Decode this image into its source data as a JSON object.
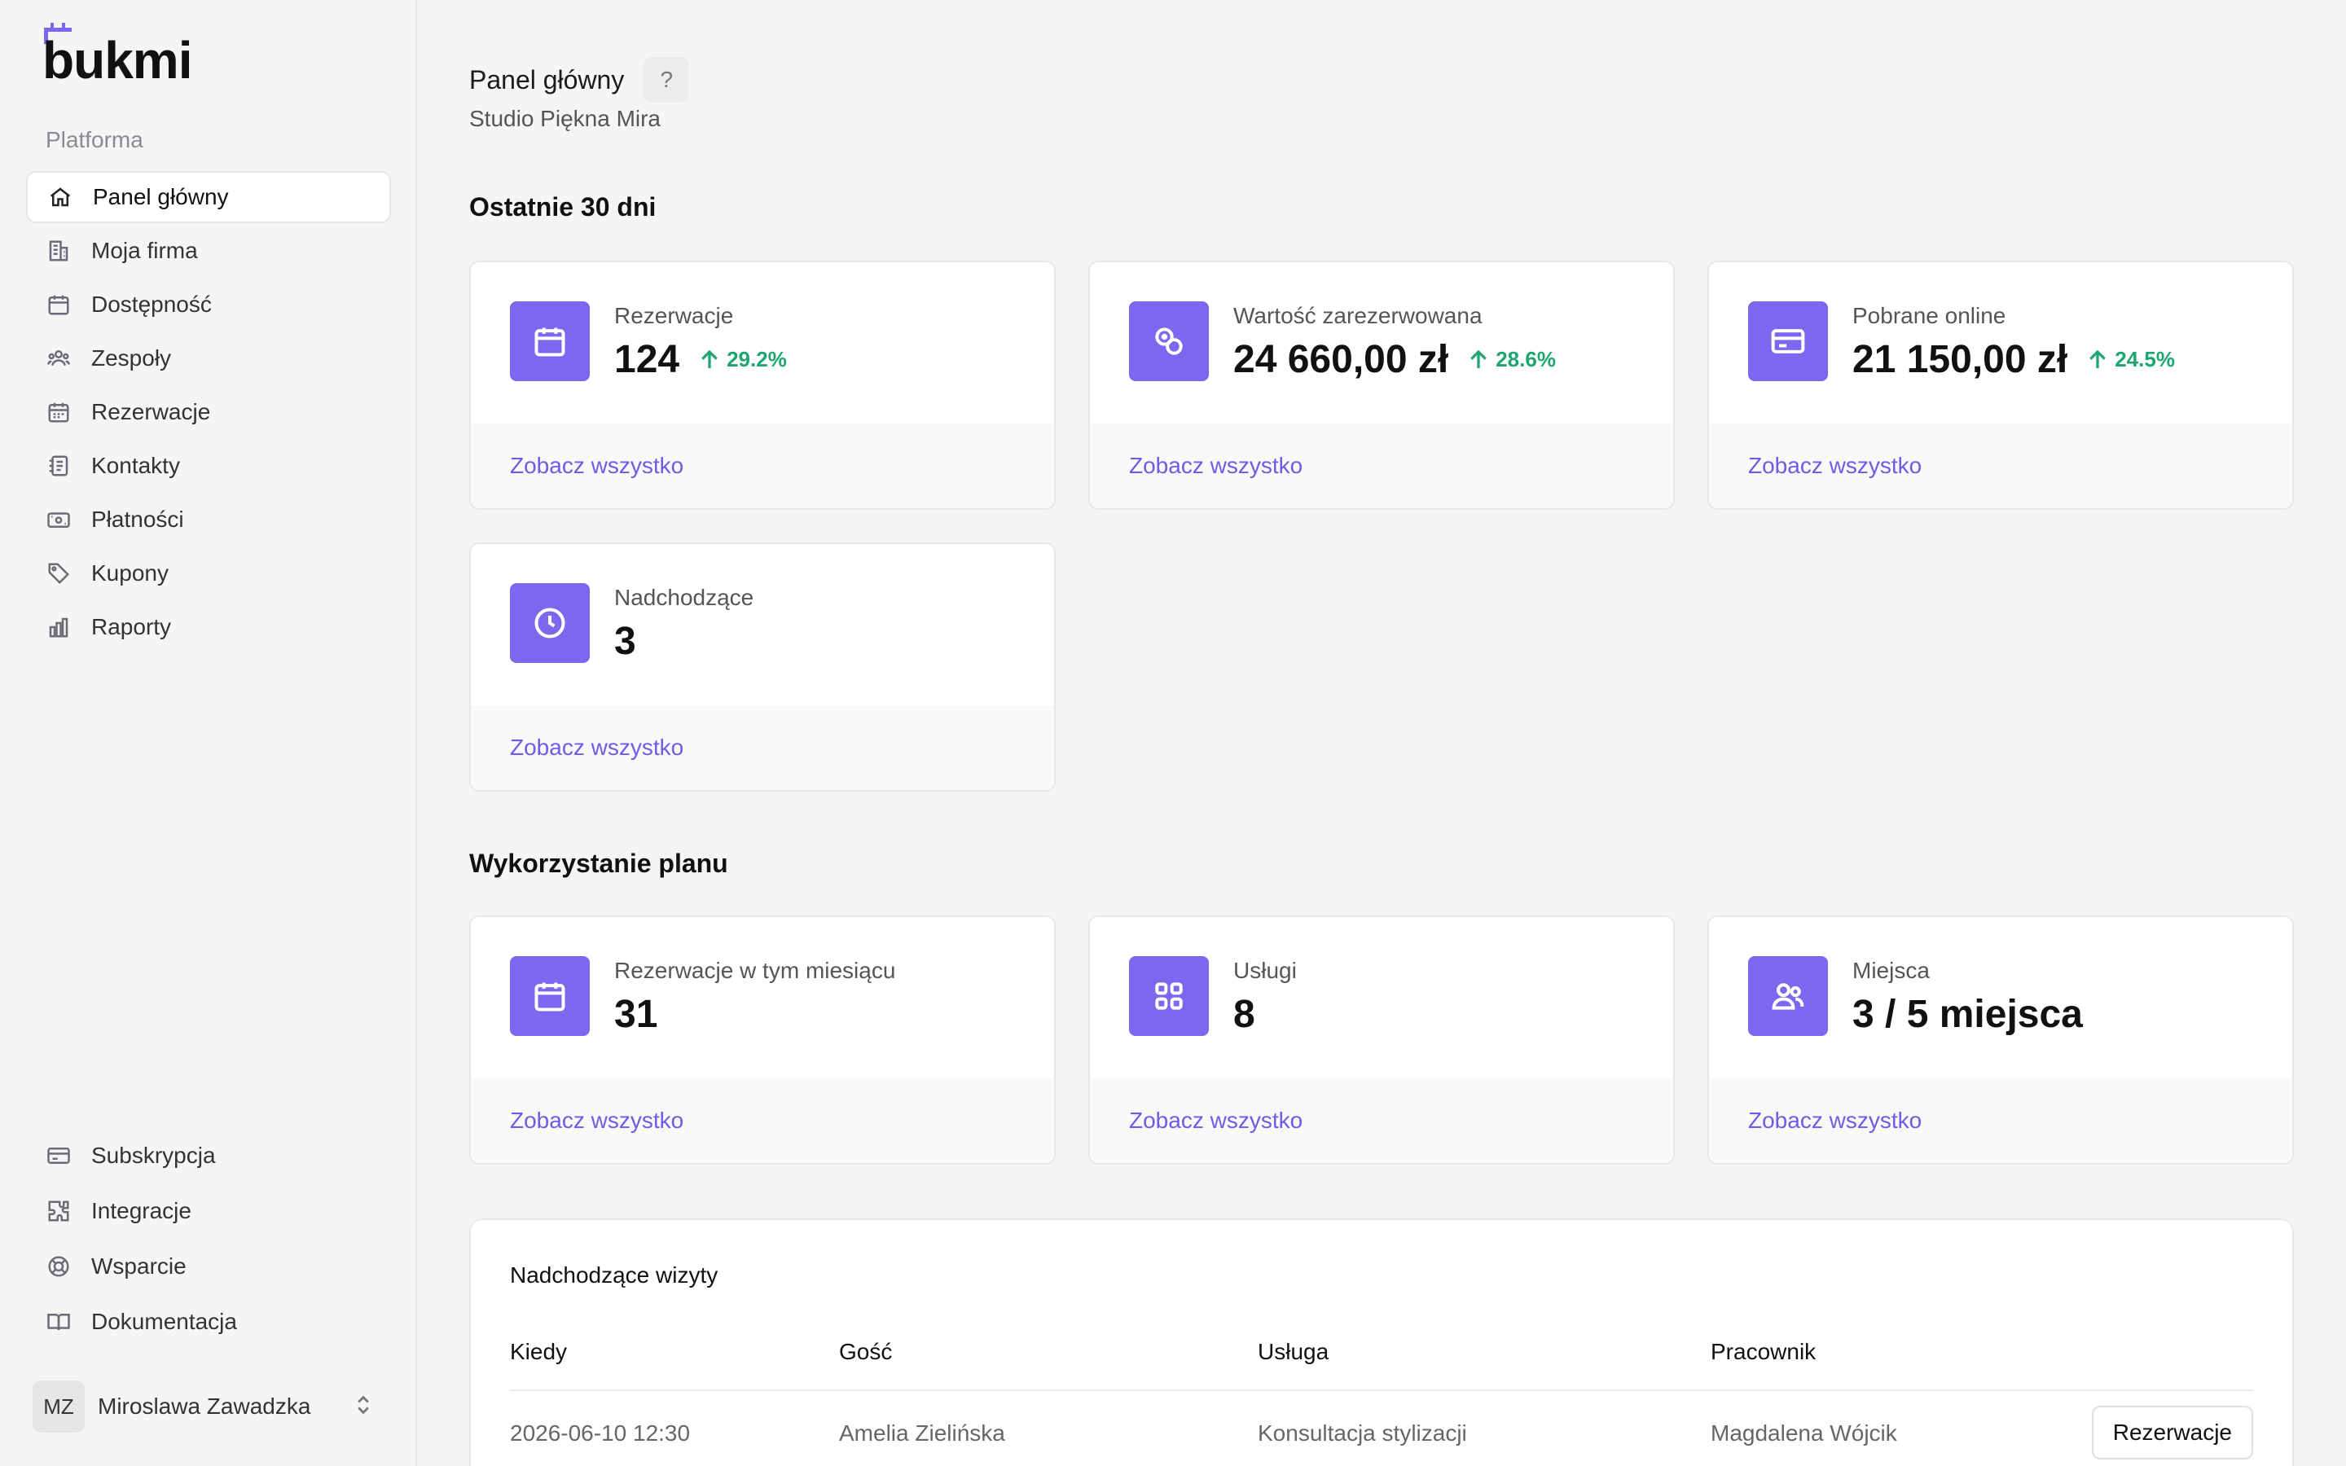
{
  "brand": {
    "name": "bukmi",
    "accent": "#7b68ee"
  },
  "sidebar": {
    "group_label": "Platforma",
    "items": [
      {
        "label": "Panel główny",
        "icon": "home-icon",
        "active": true
      },
      {
        "label": "Moja firma",
        "icon": "building-icon"
      },
      {
        "label": "Dostępność",
        "icon": "calendar-icon"
      },
      {
        "label": "Zespoły",
        "icon": "users-icon"
      },
      {
        "label": "Rezerwacje",
        "icon": "calendar-grid-icon"
      },
      {
        "label": "Kontakty",
        "icon": "contacts-icon"
      },
      {
        "label": "Płatności",
        "icon": "banknote-icon"
      },
      {
        "label": "Kupony",
        "icon": "tag-icon"
      },
      {
        "label": "Raporty",
        "icon": "bar-chart-icon"
      }
    ],
    "bottom_items": [
      {
        "label": "Subskrypcja",
        "icon": "credit-card-icon"
      },
      {
        "label": "Integracje",
        "icon": "puzzle-icon"
      },
      {
        "label": "Wsparcie",
        "icon": "lifebuoy-icon"
      },
      {
        "label": "Dokumentacja",
        "icon": "book-icon"
      }
    ],
    "user": {
      "initials": "MZ",
      "name": "Miroslawa Zawadzka"
    }
  },
  "header": {
    "title": "Panel główny",
    "help": "?",
    "subtitle": "Studio Piękna Mira"
  },
  "stats": {
    "title": "Ostatnie 30 dni",
    "cards": [
      {
        "label": "Rezerwacje",
        "value": "124",
        "trend": "29.2%",
        "icon": "calendar-icon",
        "link": "Zobacz wszystko"
      },
      {
        "label": "Wartość zarezerwowana",
        "value": "24 660,00 zł",
        "trend": "28.6%",
        "icon": "coins-icon",
        "link": "Zobacz wszystko"
      },
      {
        "label": "Pobrane online",
        "value": "21 150,00 zł",
        "trend": "24.5%",
        "icon": "credit-card-icon",
        "link": "Zobacz wszystko"
      },
      {
        "label": "Nadchodzące",
        "value": "3",
        "icon": "clock-icon",
        "link": "Zobacz wszystko"
      }
    ]
  },
  "plan": {
    "title": "Wykorzystanie planu",
    "cards": [
      {
        "label": "Rezerwacje w tym miesiącu",
        "value": "31",
        "icon": "calendar-icon",
        "link": "Zobacz wszystko"
      },
      {
        "label": "Usługi",
        "value": "8",
        "icon": "grid-icon",
        "link": "Zobacz wszystko"
      },
      {
        "label": "Miejsca",
        "value": "3 / 5 miejsca",
        "icon": "users-icon",
        "link": "Zobacz wszystko"
      }
    ]
  },
  "upcoming": {
    "title": "Nadchodzące wizyty",
    "columns": [
      "Kiedy",
      "Gość",
      "Usługa",
      "Pracownik"
    ],
    "rows": [
      {
        "when": "2026-06-10 12:30",
        "guest": "Amelia Zielińska",
        "service": "Konsultacja stylizacji",
        "staff": "Magdalena Wójcik",
        "action": "Rezerwacje"
      }
    ]
  }
}
